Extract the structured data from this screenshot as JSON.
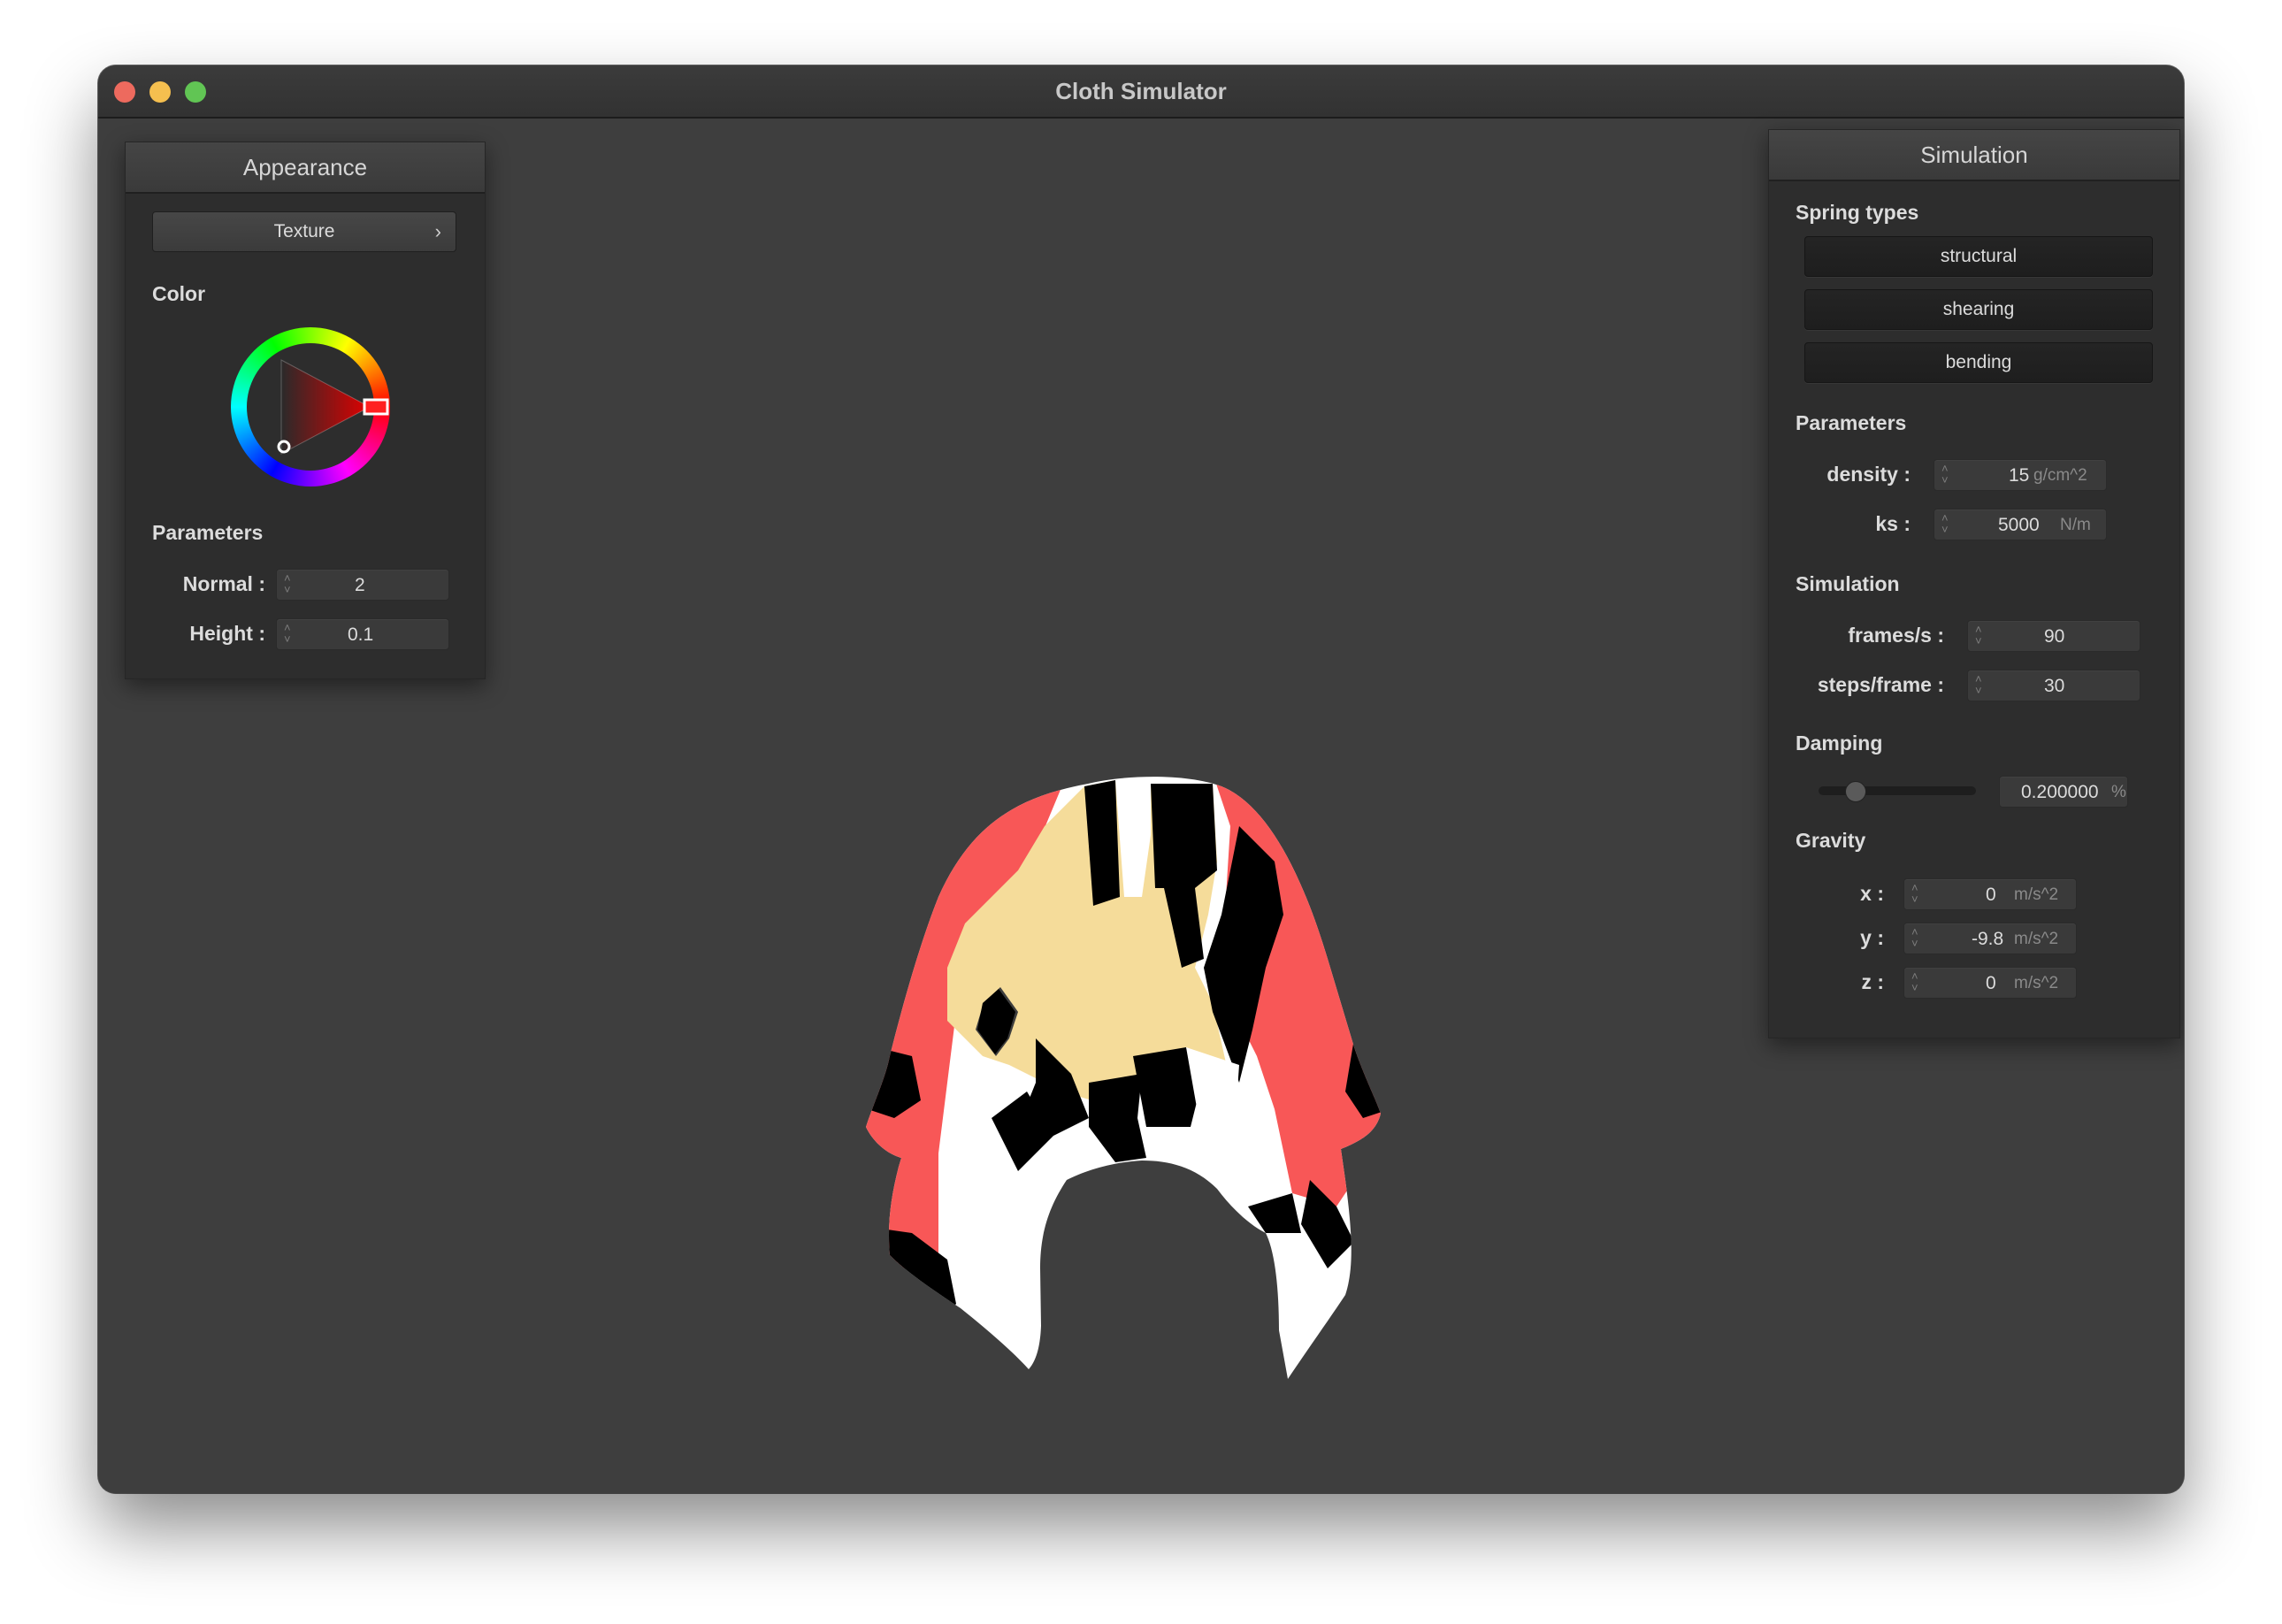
{
  "window": {
    "title": "Cloth Simulator"
  },
  "appearance": {
    "title": "Appearance",
    "texture_button": "Texture",
    "color_label": "Color",
    "color": "#ff0000",
    "params_label": "Parameters",
    "normal_label": "Normal :",
    "normal_value": "2",
    "height_label": "Height :",
    "height_value": "0.1"
  },
  "simulation": {
    "title": "Simulation",
    "spring_types_label": "Spring types",
    "spring_types": [
      "structural",
      "shearing",
      "bending"
    ],
    "parameters_label": "Parameters",
    "density_label": "density :",
    "density_value": "15",
    "density_unit": "g/cm^2",
    "ks_label": "ks :",
    "ks_value": "5000",
    "ks_unit": "N/m",
    "simulation_label": "Simulation",
    "fps_label": "frames/s :",
    "fps_value": "90",
    "steps_label": "steps/frame :",
    "steps_value": "30",
    "damping_label": "Damping",
    "damping_value": "0.200000",
    "damping_unit": "%",
    "damping_level": 0.2,
    "gravity_label": "Gravity",
    "gx_label": "x :",
    "gx_value": "0",
    "gy_label": "y :",
    "gy_value": "-9.8",
    "gz_label": "z :",
    "gz_value": "0",
    "gravity_unit": "m/s^2"
  },
  "cloth": {
    "colors": {
      "red": "#f85757",
      "cream": "#f5dc9a",
      "black": "#000000",
      "white": "#ffffff"
    }
  }
}
